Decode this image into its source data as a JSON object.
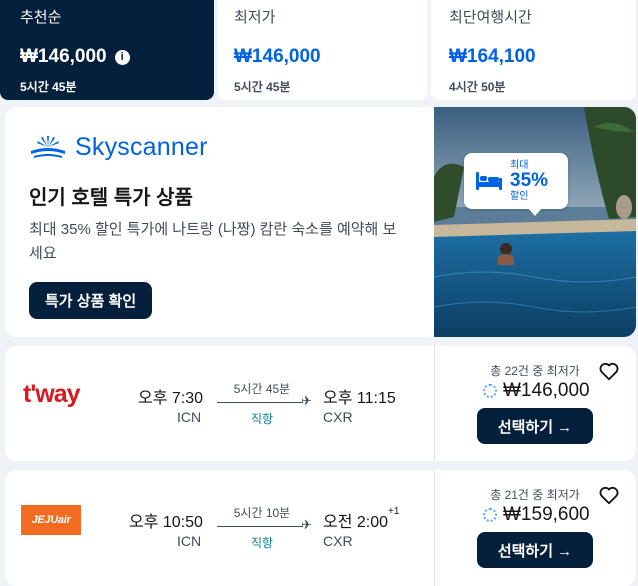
{
  "sort_tabs": [
    {
      "label": "추천순",
      "price": "₩146,000",
      "duration": "5시간 45분"
    },
    {
      "label": "최저가",
      "price": "₩146,000",
      "duration": "5시간 45분"
    },
    {
      "label": "최단여행시간",
      "price": "₩164,100",
      "duration": "4시간 50분"
    }
  ],
  "promo": {
    "logo_text": "Skyscanner",
    "title": "인기 호텔 특가 상품",
    "description": "최대 35% 할인 특가에 나트랑 (나짱) 캄란 숙소를 예약해 보세요",
    "button_label": "특가 상품 확인",
    "badge_top": "최대",
    "badge_percent": "35%",
    "badge_bottom": "할인"
  },
  "flights": [
    {
      "airline_logo_text": "t'way",
      "dep_time": "오후 7:30",
      "dep_code": "ICN",
      "duration": "5시간 45분",
      "stops": "직항",
      "arr_time": "오후 11:15",
      "arr_code": "CXR",
      "arr_day_offset": "",
      "deal_text": "총 22건 중 최저가",
      "price": "₩146,000",
      "select_label": "선택하기 →"
    },
    {
      "airline_logo_text": "JEJUair",
      "dep_time": "오후 10:50",
      "dep_code": "ICN",
      "duration": "5시간 10분",
      "stops": "직항",
      "arr_time": "오전 2:00",
      "arr_code": "CXR",
      "arr_day_offset": "+1",
      "deal_text": "총 21건 중 최저가",
      "price": "₩159,600",
      "select_label": "선택하기 →"
    }
  ],
  "colors": {
    "navy": "#05203c",
    "blue": "#0062e3",
    "teal": "#0c838a"
  }
}
